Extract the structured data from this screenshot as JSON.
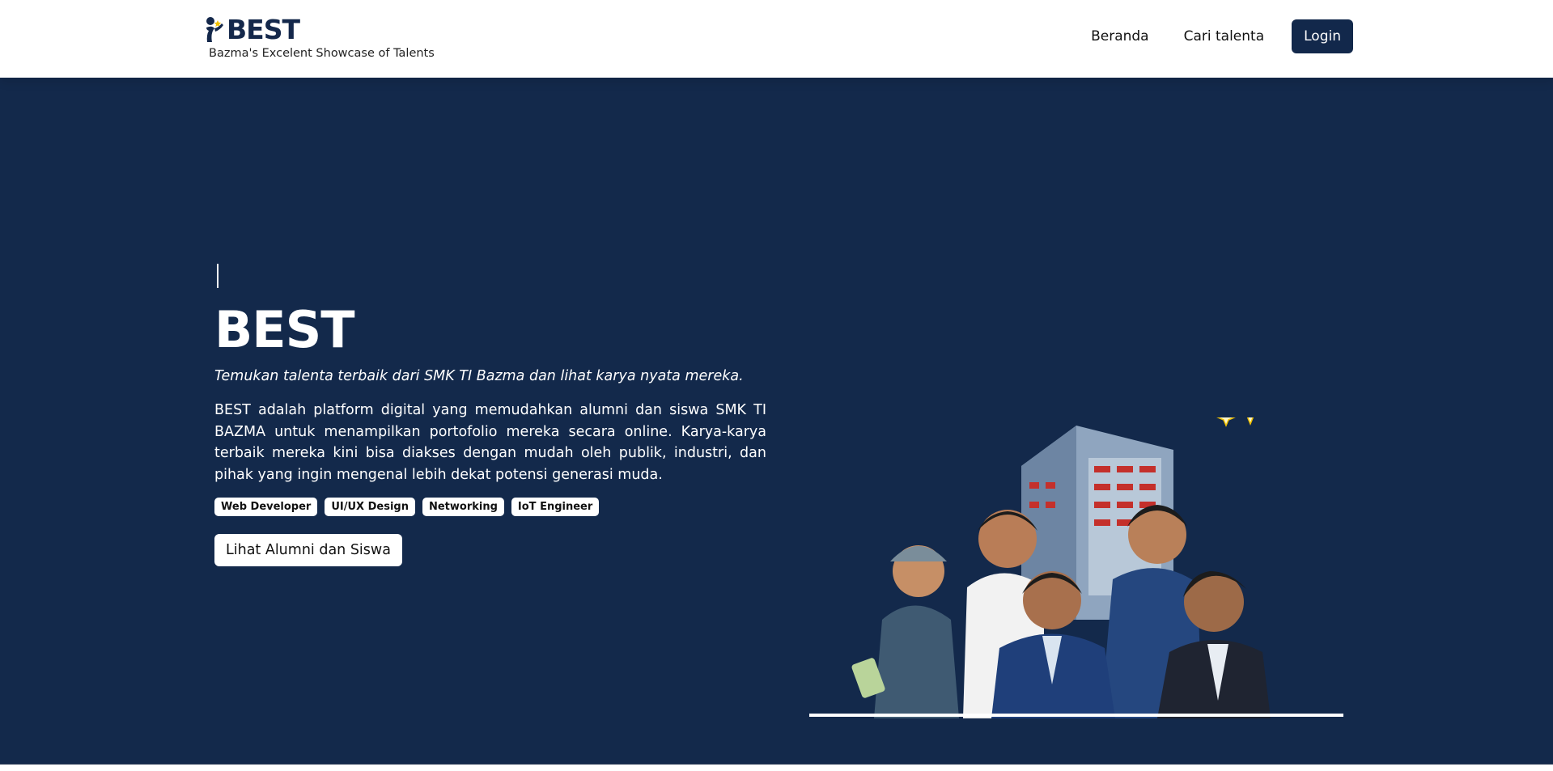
{
  "header": {
    "logo_text": "BEST",
    "tagline": "Bazma's Excelent Showcase of Talents",
    "nav": [
      {
        "label": "Beranda"
      },
      {
        "label": "Cari talenta"
      }
    ],
    "login_label": "Login"
  },
  "hero": {
    "title": "BEST",
    "tagline": "Temukan talenta terbaik dari SMK TI Bazma dan lihat karya nyata mereka.",
    "description": "BEST adalah platform digital yang memudahkan alumni dan siswa SMK TI BAZMA untuk menampilkan portofolio mereka secara online. Karya-karya terbaik mereka kini bisa diakses dengan mudah oleh publik, industri, dan pihak yang ingin mengenal lebih dekat potensi generasi muda.",
    "tags": [
      "Web Developer",
      "UI/UX Design",
      "Networking",
      "IoT Engineer"
    ],
    "cta_label": "Lihat Alumni dan Siswa",
    "image_icon": "students-group-illustration"
  },
  "colors": {
    "primary": "#13294b",
    "login_bg": "#12284b",
    "star": "#f2c200",
    "text_on_dark": "#ffffff"
  }
}
